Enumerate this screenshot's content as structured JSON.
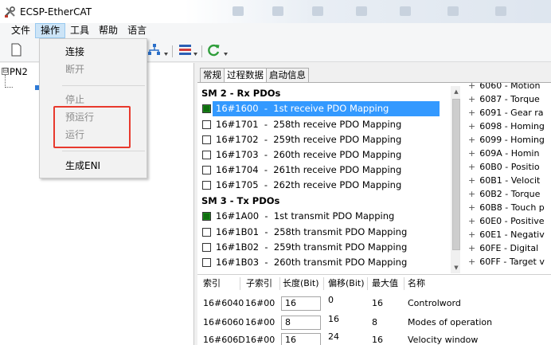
{
  "window": {
    "title": "ECSP-EtherCAT"
  },
  "menubar": {
    "items": [
      "文件",
      "操作",
      "工具",
      "帮助",
      "语言"
    ],
    "active_index": 1
  },
  "dropdown": {
    "items": [
      {
        "label": "连接",
        "enabled": true
      },
      {
        "label": "断开",
        "enabled": false
      },
      {
        "label": "停止",
        "enabled": false
      },
      {
        "label": "预运行",
        "enabled": false
      },
      {
        "label": "运行",
        "enabled": false
      },
      {
        "label": "生成ENI",
        "enabled": true
      }
    ],
    "highlight_color": "#e8392d"
  },
  "tree": {
    "root_label": "PN2",
    "expander": "⊟"
  },
  "tabs": [
    "常规",
    "过程数据",
    "启动信息"
  ],
  "active_tab": 1,
  "pdo_list": {
    "rx_header": "SM 2 - Rx PDOs",
    "rx_items": [
      {
        "label": "16#1600  -  1st receive PDO Mapping",
        "checked": true,
        "selected": true
      },
      {
        "label": "16#1701  -  258th receive PDO Mapping",
        "checked": false,
        "selected": false
      },
      {
        "label": "16#1702  -  259th receive PDO Mapping",
        "checked": false,
        "selected": false
      },
      {
        "label": "16#1703  -  260th receive PDO Mapping",
        "checked": false,
        "selected": false
      },
      {
        "label": "16#1704  -  261th receive PDO Mapping",
        "checked": false,
        "selected": false
      },
      {
        "label": "16#1705  -  262th receive PDO Mapping",
        "checked": false,
        "selected": false
      }
    ],
    "tx_header": "SM 3 - Tx PDOs",
    "tx_items": [
      {
        "label": "16#1A00  -  1st transmit PDO Mapping",
        "checked": true,
        "selected": false
      },
      {
        "label": "16#1B01  -  258th transmit PDO Mapping",
        "checked": false,
        "selected": false
      },
      {
        "label": "16#1B02  -  259th transmit PDO Mapping",
        "checked": false,
        "selected": false
      },
      {
        "label": "16#1B03  -  260th transmit PDO Mapping",
        "checked": false,
        "selected": false
      }
    ]
  },
  "entries": [
    "6060 - Motion",
    "6087 - Torque",
    "6091 - Gear ra",
    "6098 - Homing",
    "6099 - Homing",
    "609A - Homin",
    "60B0 - Positio",
    "60B1 - Velocit",
    "60B2 - Torque",
    "60B8 - Touch p",
    "60E0 - Positive",
    "60E1 - Negativ",
    "60FE - Digital",
    "60FF - Target v"
  ],
  "grid": {
    "headers": [
      "索引",
      "子索引",
      "长度(Bit)",
      "偏移(Bit)",
      "最大值",
      "名称"
    ],
    "rows": [
      {
        "index": "16#6040",
        "subindex": "16#00",
        "length": "16",
        "offset": "0",
        "max": "16",
        "name": "Controlword"
      },
      {
        "index": "16#6060",
        "subindex": "16#00",
        "length": "8",
        "offset": "16",
        "max": "8",
        "name": "Modes of operation"
      },
      {
        "index": "16#606D",
        "subindex": "16#00",
        "length": "16",
        "offset": "24",
        "max": "16",
        "name": "Velocity window"
      }
    ]
  },
  "colors": {
    "selection": "#3399ff",
    "checked": "#1e8a1e",
    "menu_active": "#cce4f7"
  }
}
